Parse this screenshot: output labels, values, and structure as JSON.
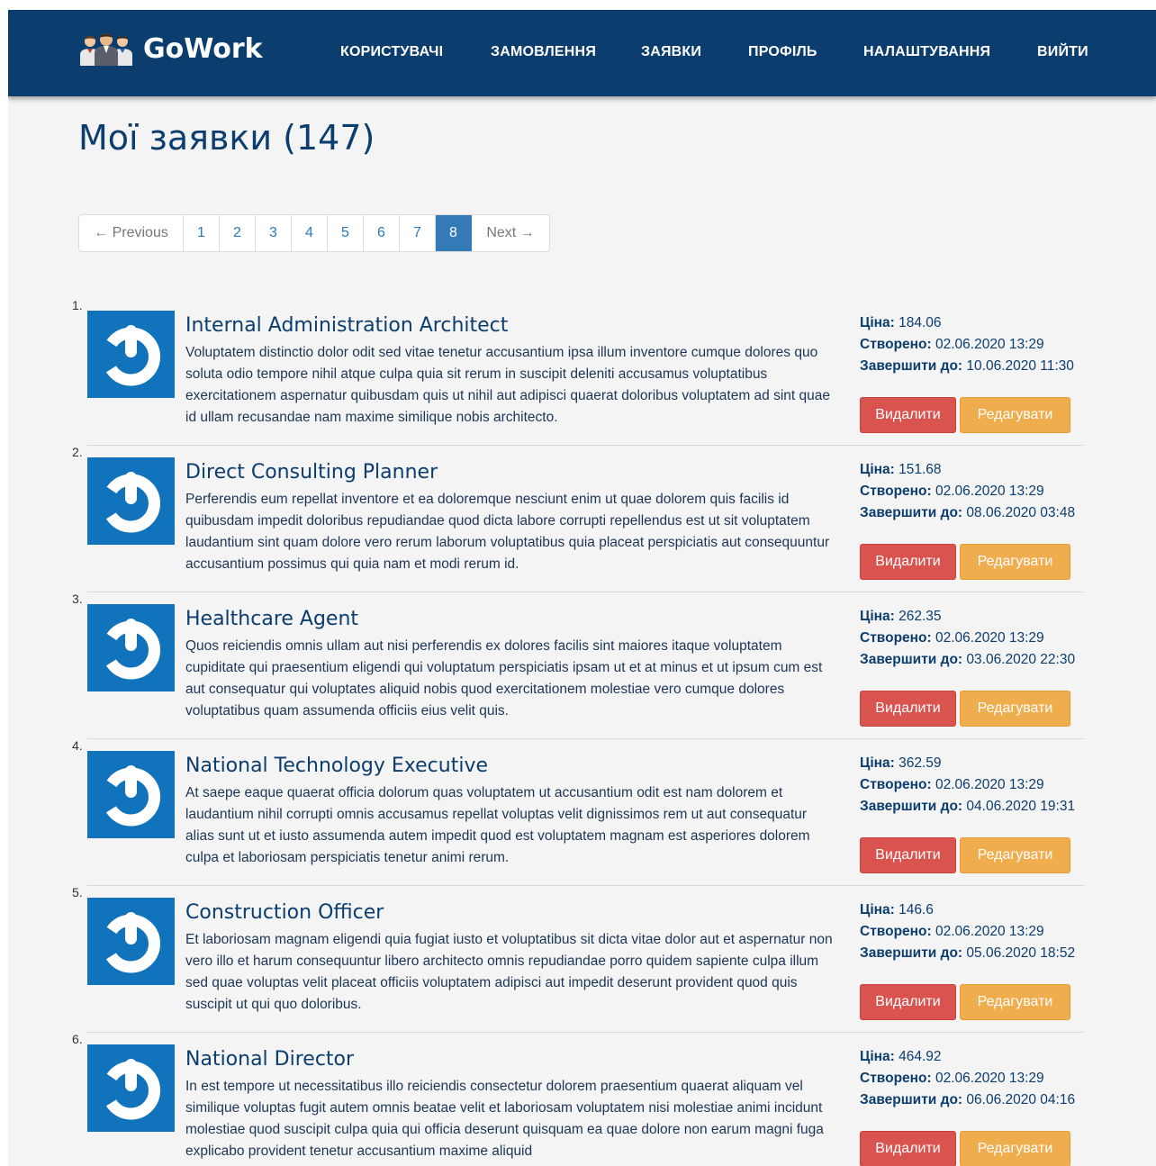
{
  "brand": {
    "name": "GoWork",
    "logo_icon": "users-group-icon"
  },
  "nav": {
    "users": "КОРИСТУВАЧІ",
    "orders": "ЗАМОВЛЕННЯ",
    "requests": "ЗАЯВКИ",
    "profile": "ПРОФІЛЬ",
    "settings": "НАЛАШТУВАННЯ",
    "logout": "ВИЙТИ"
  },
  "page_title": "Мої заявки (147)",
  "pagination": {
    "previous": "← Previous",
    "pages": [
      "1",
      "2",
      "3",
      "4",
      "5",
      "6",
      "7",
      "8"
    ],
    "current": "8",
    "next": "Next →"
  },
  "labels": {
    "price": "Ціна:",
    "created": "Створено:",
    "finish_by": "Завершити до:",
    "delete": "Видалити",
    "edit": "Редагувати"
  },
  "items": [
    {
      "number": "1.",
      "title": "Internal Administration Architect",
      "description": "Voluptatem distinctio dolor odit sed vitae tenetur accusantium ipsa illum inventore cumque dolores quo soluta odio tempore nihil atque culpa quia sit rerum in suscipit deleniti accusamus voluptatibus exercitationem aspernatur quibusdam quis ut nihil aut adipisci quaerat doloribus voluptatem ad sint quae id ullam recusandae nam maxime similique nobis architecto.",
      "price": "184.06",
      "created": "02.06.2020 13:29",
      "finish_by": "10.06.2020 11:30"
    },
    {
      "number": "2.",
      "title": "Direct Consulting Planner",
      "description": "Perferendis eum repellat inventore et ea doloremque nesciunt enim ut quae dolorem quis facilis id quibusdam impedit doloribus repudiandae quod dicta labore corrupti repellendus est ut sit voluptatem laudantium sint quam dolore vero rerum laborum voluptatibus quia placeat perspiciatis aut consequuntur accusantium possimus qui quia nam et modi rerum id.",
      "price": "151.68",
      "created": "02.06.2020 13:29",
      "finish_by": "08.06.2020 03:48"
    },
    {
      "number": "3.",
      "title": "Healthcare Agent",
      "description": "Quos reiciendis omnis ullam aut nisi perferendis ex dolores facilis sint maiores itaque voluptatem cupiditate qui praesentium eligendi qui voluptatum perspiciatis ipsam ut et at minus et ut ipsum cum est aut consequatur qui voluptates aliquid nobis quod exercitationem molestiae vero cumque dolores voluptatibus quam assumenda officiis eius velit quis.",
      "price": "262.35",
      "created": "02.06.2020 13:29",
      "finish_by": "03.06.2020 22:30"
    },
    {
      "number": "4.",
      "title": "National Technology Executive",
      "description": "At saepe eaque quaerat officia dolorum quas voluptatem ut accusantium odit est nam dolorem et laudantium nihil corrupti omnis accusamus repellat voluptas velit dignissimos rem ut aut consequatur alias sunt ut et iusto assumenda autem impedit quod est voluptatem magnam est asperiores dolorem culpa et laboriosam perspiciatis tenetur animi rerum.",
      "price": "362.59",
      "created": "02.06.2020 13:29",
      "finish_by": "04.06.2020 19:31"
    },
    {
      "number": "5.",
      "title": "Construction Officer",
      "description": "Et laboriosam magnam eligendi quia fugiat iusto et voluptatibus sit dicta vitae dolor aut et aspernatur non vero illo et harum consequuntur libero architecto omnis repudiandae porro quidem sapiente culpa illum sed quae voluptas velit placeat officiis voluptatem adipisci aut impedit deserunt provident quod quis suscipit ut qui quo doloribus.",
      "price": "146.6",
      "created": "02.06.2020 13:29",
      "finish_by": "05.06.2020 18:52"
    },
    {
      "number": "6.",
      "title": "National Director",
      "description": "In est tempore ut necessitatibus illo reiciendis consectetur dolorem praesentium quaerat aliquam vel similique voluptas fugit autem omnis beatae velit et laboriosam voluptatem nisi molestiae animi incidunt molestiae quod suscipit culpa quia qui officia deserunt quisquam ea quae dolore non earum magni fuga explicabo provident tenetur accusantium maxime aliquid",
      "price": "464.92",
      "created": "02.06.2020 13:29",
      "finish_by": "06.06.2020 04:16"
    }
  ],
  "item_icon": "power-icon",
  "colors": {
    "navbar": "#0b3d6e",
    "accent": "#337ab7",
    "delete": "#d9534f",
    "edit": "#f0ad4e",
    "thumbnail": "#1173bb"
  }
}
